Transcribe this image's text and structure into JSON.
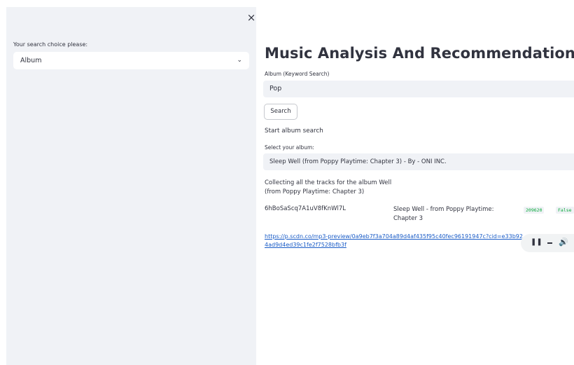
{
  "sidebar": {
    "close_icon": "×",
    "search_choice_label": "Your search choice please:",
    "search_choice_value": "Album",
    "chevron_icon": "⌄"
  },
  "main": {
    "title": "Music Analysis And Recommendation",
    "album_input_label": "Album (Keyword Search)",
    "album_input_value": "Pop",
    "search_button": "Search",
    "start_text": "Start album search",
    "select_album_label": "Select your album:",
    "select_album_value": "Sleep Well (from Poppy Playtime: Chapter 3) - By - ONI INC.",
    "chevron_icon": "⌄",
    "collecting_text": "Collecting all the tracks for the album Well (from Poppy Playtime: Chapter 3)",
    "track": {
      "id": "6hBoSaScq7A1uV8fKnWl7L",
      "name": "Sleep Well - from Poppy Playtime: Chapter 3",
      "duration": "209620",
      "explicit": "False"
    },
    "preview_url": "https://p.scdn.co/mp3-preview/0a9eb7f3a704a89d4af435f95c40fec96191947c?cid=e33b924ad9d4ed39c1fe2f7528bfb3f",
    "audio": {
      "pause_icon": "❚❚",
      "volume_icon": "🔊"
    }
  }
}
